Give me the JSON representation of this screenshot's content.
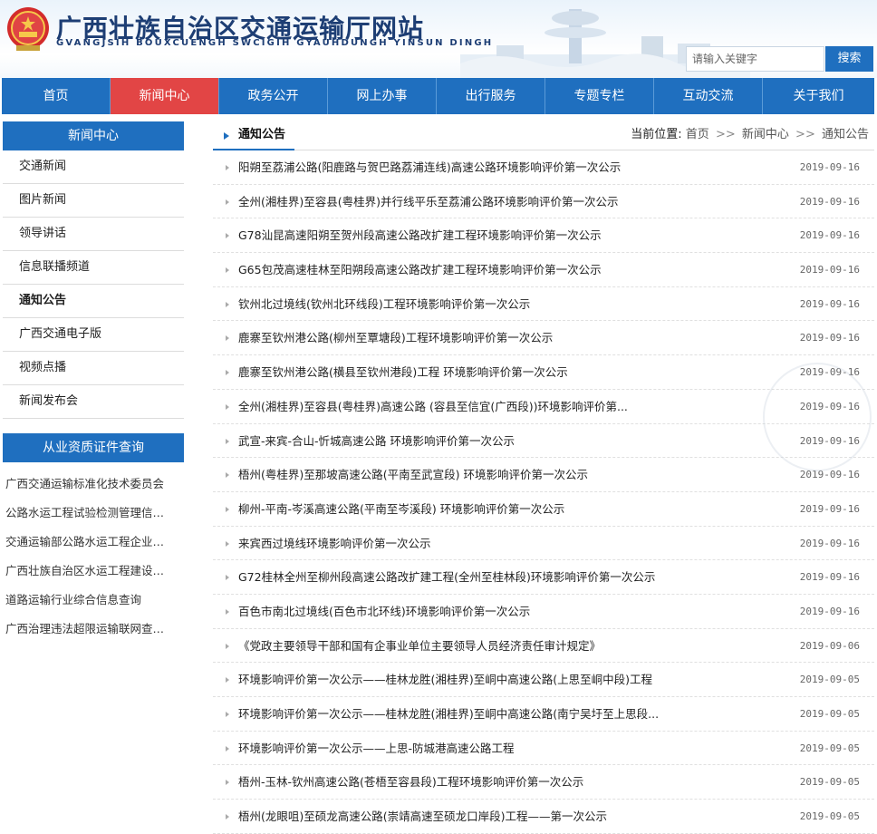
{
  "header": {
    "title": "广西壮族自治区交通运输厅网站",
    "subtitle": "GVANGJSIH BOUXCUENGH SWCIGIH GYAUHDUNGH YINSUN DINGH",
    "search_placeholder": "请输入关键字",
    "search_button": "搜索",
    "emblem_icon": "national-emblem-icon"
  },
  "nav": {
    "items": [
      {
        "label": "首页"
      },
      {
        "label": "新闻中心"
      },
      {
        "label": "政务公开"
      },
      {
        "label": "网上办事"
      },
      {
        "label": "出行服务"
      },
      {
        "label": "专题专栏"
      },
      {
        "label": "互动交流"
      },
      {
        "label": "关于我们"
      }
    ],
    "active_index": 1,
    "accent_color": "#1f6fbf",
    "active_color": "#e24545"
  },
  "sidebar": {
    "title": "新闻中心",
    "items": [
      {
        "label": "交通新闻"
      },
      {
        "label": "图片新闻"
      },
      {
        "label": "领导讲话"
      },
      {
        "label": "信息联播频道"
      },
      {
        "label": "通知公告"
      },
      {
        "label": "广西交通电子版"
      },
      {
        "label": "视频点播"
      },
      {
        "label": "新闻发布会"
      }
    ],
    "active_index": 4,
    "section2_title": "从业资质证件查询",
    "links": [
      {
        "label": "广西交通运输标准化技术委员会"
      },
      {
        "label": "公路水运工程试验检测管理信…"
      },
      {
        "label": "交通运输部公路水运工程企业…"
      },
      {
        "label": "广西壮族自治区水运工程建设…"
      },
      {
        "label": "道路运输行业综合信息查询"
      },
      {
        "label": "广西治理违法超限运输联网查…"
      }
    ]
  },
  "main": {
    "title": "通知公告",
    "breadcrumb": {
      "label": "当前位置:",
      "home": "首页",
      "sep": ">>",
      "level1": "新闻中心",
      "level2": "通知公告"
    },
    "rows": [
      {
        "title": "阳朔至荔浦公路(阳鹿路与贺巴路荔浦连线)高速公路环境影响评价第一次公示",
        "date": "2019-09-16"
      },
      {
        "title": "全州(湘桂界)至容县(粤桂界)并行线平乐至荔浦公路环境影响评价第一次公示",
        "date": "2019-09-16"
      },
      {
        "title": "G78汕昆高速阳朔至贺州段高速公路改扩建工程环境影响评价第一次公示",
        "date": "2019-09-16"
      },
      {
        "title": "G65包茂高速桂林至阳朔段高速公路改扩建工程环境影响评价第一次公示",
        "date": "2019-09-16"
      },
      {
        "title": "钦州北过境线(钦州北环线段)工程环境影响评价第一次公示",
        "date": "2019-09-16"
      },
      {
        "title": "鹿寨至钦州港公路(柳州至覃塘段)工程环境影响评价第一次公示",
        "date": "2019-09-16"
      },
      {
        "title": "鹿寨至钦州港公路(横县至钦州港段)工程 环境影响评价第一次公示",
        "date": "2019-09-16"
      },
      {
        "title": "全州(湘桂界)至容县(粤桂界)高速公路 (容县至信宜(广西段))环境影响评价第...",
        "date": "2019-09-16"
      },
      {
        "title": "武宣-来宾-合山-忻城高速公路 环境影响评价第一次公示",
        "date": "2019-09-16"
      },
      {
        "title": "梧州(粤桂界)至那坡高速公路(平南至武宣段) 环境影响评价第一次公示",
        "date": "2019-09-16"
      },
      {
        "title": "柳州-平南-岑溪高速公路(平南至岑溪段) 环境影响评价第一次公示",
        "date": "2019-09-16"
      },
      {
        "title": "来宾西过境线环境影响评价第一次公示",
        "date": "2019-09-16"
      },
      {
        "title": "G72桂林全州至柳州段高速公路改扩建工程(全州至桂林段)环境影响评价第一次公示",
        "date": "2019-09-16"
      },
      {
        "title": "百色市南北过境线(百色市北环线)环境影响评价第一次公示",
        "date": "2019-09-16"
      },
      {
        "title": "《党政主要领导干部和国有企事业单位主要领导人员经济责任审计规定》",
        "date": "2019-09-06"
      },
      {
        "title": "环境影响评价第一次公示——桂林龙胜(湘桂界)至峒中高速公路(上思至峒中段)工程",
        "date": "2019-09-05"
      },
      {
        "title": "环境影响评价第一次公示——桂林龙胜(湘桂界)至峒中高速公路(南宁吴圩至上思段...",
        "date": "2019-09-05"
      },
      {
        "title": "环境影响评价第一次公示——上思-防城港高速公路工程",
        "date": "2019-09-05"
      },
      {
        "title": "梧州-玉林-钦州高速公路(苍梧至容县段)工程环境影响评价第一次公示",
        "date": "2019-09-05"
      },
      {
        "title": "梧州(龙眼咀)至硕龙高速公路(崇靖高速至硕龙口岸段)工程——第一次公示",
        "date": "2019-09-05"
      }
    ]
  }
}
